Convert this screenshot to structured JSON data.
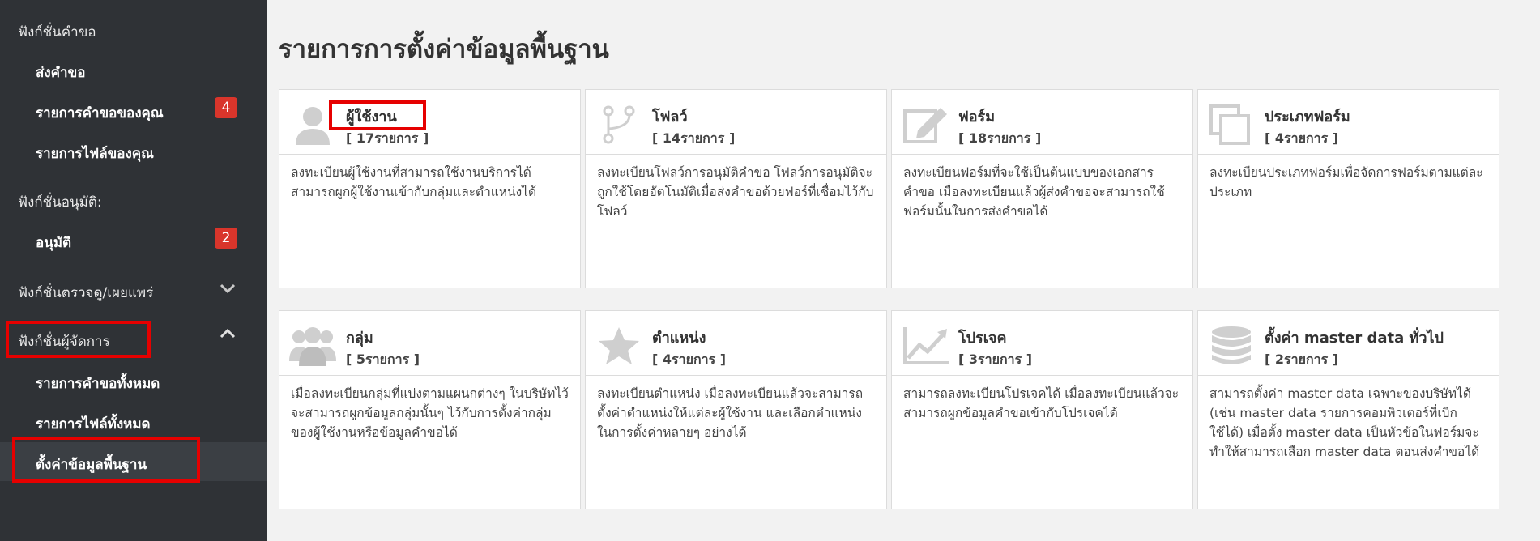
{
  "sidebar": {
    "section_request": "ฟังก์ชั่นคำขอ",
    "item_send_request": "ส่งคำขอ",
    "item_your_requests": "รายการคำขอของคุณ",
    "badge_your_requests": "4",
    "item_your_files": "รายการไฟล์ของคุณ",
    "section_approve": "ฟังก์ชั่นอนุมัติ:",
    "item_approve": "อนุมัติ",
    "badge_approve": "2",
    "section_inspect": "ฟังก์ชั่นตรวจดู/เผยแพร่",
    "section_manager": "ฟังก์ชั่นผู้จัดการ",
    "item_all_requests": "รายการคำขอทั้งหมด",
    "item_all_files": "รายการไฟล์ทั้งหมด",
    "item_basic_settings": "ตั้งค่าข้อมูลพื้นฐาน"
  },
  "main": {
    "title": "รายการการตั้งค่าข้อมูลพื้นฐาน",
    "cards": [
      {
        "title": "ผู้ใช้งาน",
        "count": "[ 17รายการ ]",
        "icon": "user-icon",
        "desc": "ลงทะเบียนผู้ใช้งานที่สามารถใช้งานบริการได้ สามารถผูกผู้ใช้งานเข้ากับกลุ่มและตำแหน่งได้"
      },
      {
        "title": "โฟลว์",
        "count": "[ 14รายการ ]",
        "icon": "flow-icon",
        "desc": "ลงทะเบียนโฟลว์การอนุมัติคำขอ โฟลว์การอนุมัติจะถูกใช้โดยอัตโนมัติเมื่อส่งคำขอด้วยฟอร์ที่เชื่อมไว้กับโฟลว์"
      },
      {
        "title": "ฟอร์ม",
        "count": "[ 18รายการ ]",
        "icon": "edit-icon",
        "desc": "ลงทะเบียนฟอร์มที่จะใช้เป็นต้นแบบของเอกสารคำขอ เมื่อลงทะเบียนแล้วผู้ส่งคำขอจะสามารถใช้ฟอร์มนั้นในการส่งคำขอได้"
      },
      {
        "title": "ประเภทฟอร์ม",
        "count": "[ 4รายการ ]",
        "icon": "copy-icon",
        "desc": "ลงทะเบียนประเภทฟอร์มเพื่อจัดการฟอร์มตามแต่ละประเภท"
      },
      {
        "title": "กลุ่ม",
        "count": "[ 5รายการ ]",
        "icon": "group-icon",
        "desc": "เมื่อลงทะเบียนกลุ่มที่แบ่งตามแผนกต่างๆ ในบริษัทไว้ จะสามารถผูกข้อมูลกลุ่มนั้นๆ ไว้กับการตั้งค่ากลุ่มของผู้ใช้งานหรือข้อมูลคำขอได้"
      },
      {
        "title": "ตำแหน่ง",
        "count": "[ 4รายการ ]",
        "icon": "star-icon",
        "desc": "ลงทะเบียนตำแหน่ง เมื่อลงทะเบียนแล้วจะสามารถตั้งค่าตำแหน่งให้แต่ละผู้ใช้งาน และเลือกตำแหน่งในการตั้งค่าหลายๆ อย่างได้"
      },
      {
        "title": "โปรเจค",
        "count": "[ 3รายการ ]",
        "icon": "chart-icon",
        "desc": "สามารถลงทะเบียนโปรเจคได้ เมื่อลงทะเบียนแล้วจะสามารถผูกข้อมูลคำขอเข้ากับโปรเจคได้"
      },
      {
        "title": "ตั้งค่า master data ทั่วไป",
        "count": "[ 2รายการ ]",
        "icon": "database-icon",
        "desc": "สามารถตั้งค่า master data เฉพาะของบริษัทได้ (เช่น master data รายการคอมพิวเตอร์ที่เบิกใช้ได้) เมื่อตั้ง master data เป็นหัวข้อในฟอร์มจะทำให้สามารถเลือก master data ตอนส่งคำขอได้"
      }
    ]
  }
}
